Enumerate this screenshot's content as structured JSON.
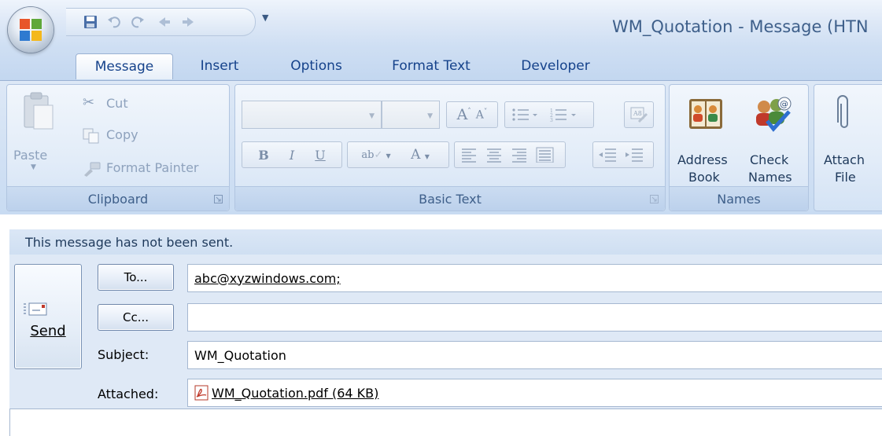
{
  "window": {
    "title": "WM_Quotation - Message (HTN"
  },
  "tabs": [
    "Message",
    "Insert",
    "Options",
    "Format Text",
    "Developer"
  ],
  "clipboard": {
    "paste": "Paste",
    "cut": "Cut",
    "copy": "Copy",
    "format_painter": "Format Painter",
    "label": "Clipboard"
  },
  "basic_text": {
    "label": "Basic Text",
    "bold": "B",
    "italic": "I",
    "underline": "U",
    "grow_font": "A",
    "shrink_font": "A",
    "font_color": "A"
  },
  "names": {
    "address_book_line1": "Address",
    "address_book_line2": "Book",
    "check_names_line1": "Check",
    "check_names_line2": "Names",
    "label": "Names"
  },
  "include": {
    "attach_line1": "Attach",
    "attach_line2": "File"
  },
  "infobar": {
    "text": "This message has not been sent."
  },
  "send": {
    "label": "Send"
  },
  "fields": {
    "to_button": "To...",
    "to_value": "abc@xyzwindows.com;",
    "cc_button": "Cc...",
    "cc_value": "",
    "subject_label": "Subject:",
    "subject_value": "WM_Quotation",
    "attached_label": "Attached:",
    "attachment": "WM_Quotation.pdf (64 KB)"
  }
}
